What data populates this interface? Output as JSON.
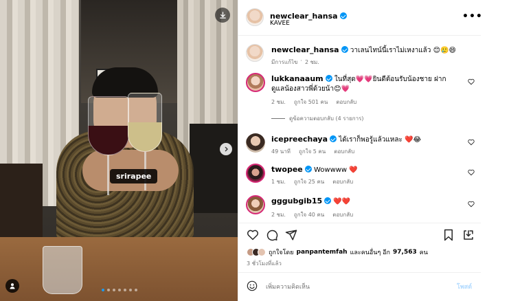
{
  "photo": {
    "tag_label": "srirapee",
    "slide_count": 7,
    "active_slide": 1
  },
  "header": {
    "username": "newclear_hansa",
    "subtitle": "KAVEE"
  },
  "caption": {
    "username": "newclear_hansa",
    "text": "วาเลนไทน์นี้เราไม่เหงาแล้ว 😊🥲😄",
    "edited": "มีการแก้ไข",
    "time": "2 ชม."
  },
  "comments": [
    {
      "username": "lukkanaaum",
      "text": "ในที่สุด💗💗ยินดีต้อนรับน้องชาย ฝากดูแลน้องสาวพี่ด้วยน้า😊💗",
      "time": "2 ชม.",
      "likes": "ถูกใจ 501 คน",
      "reply": "ตอบกลับ",
      "view_replies": "ดูข้อความตอบกลับ (4 รายการ)"
    },
    {
      "username": "icepreechaya",
      "text": "ได้เราก็พอรู้แล้วแหละ ❤️😂",
      "time": "49 นาที",
      "likes": "ถูกใจ 5 คน",
      "reply": "ตอบกลับ"
    },
    {
      "username": "twopee",
      "text": "Wowwww ❤️",
      "time": "1 ชม.",
      "likes": "ถูกใจ 25 คน",
      "reply": "ตอบกลับ"
    },
    {
      "username": "gggubgib15",
      "text": "❤️❤️",
      "time": "2 ชม.",
      "likes": "ถูกใจ 40 คน",
      "reply": "ตอบกลับ"
    }
  ],
  "likes_summary": {
    "prefix": "ถูกใจโดย",
    "user": "panpantemfah",
    "middle": "และคนอื่นๆ อีก",
    "count": "97,563",
    "suffix": "คน"
  },
  "posted_ago": "3 ชั่วโมงที่แล้ว",
  "comment_input": {
    "placeholder": "เพิ่มความคิดเห็น",
    "post_label": "โพสต์"
  },
  "colors": {
    "verified": "#0095f6",
    "active_dot": "#1d9bf0",
    "meta_gray": "#737373",
    "post_disabled": "#b3dbff"
  }
}
